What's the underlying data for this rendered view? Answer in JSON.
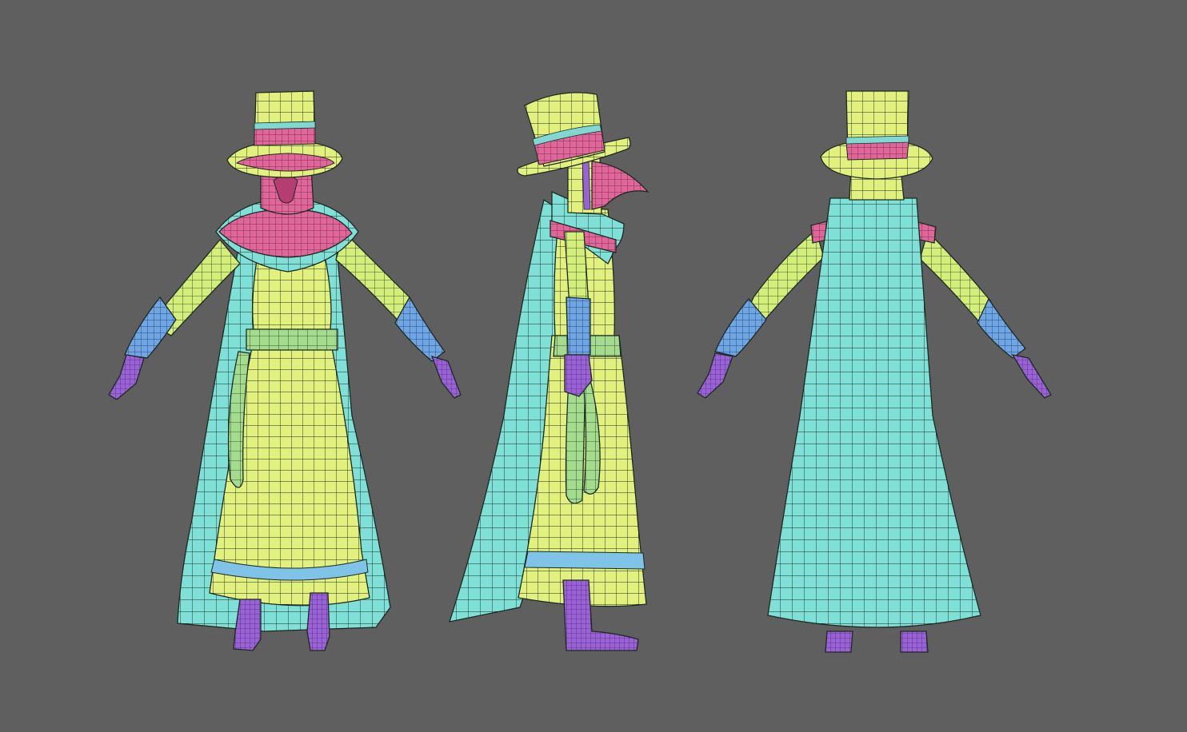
{
  "viewport": {
    "background": "#5f5f5f",
    "views": [
      "front-view",
      "side-view",
      "back-view"
    ]
  },
  "palette": {
    "hat": "#dff07a",
    "hat_band": "#d9587e",
    "hat_band_stripe": "#7fd9d2",
    "mask": "#e0669a",
    "mask_dark": "#b63d72",
    "collar_pink": "#e77aa2",
    "cape": "#7fe0d8",
    "robe": "#e2f07e",
    "robe_shadow": "#c8da60",
    "sash": "#a4dc8e",
    "robe_hem_band": "#7fc3e8",
    "arm": "#d4ee7a",
    "glove": "#6fa6e6",
    "hand": "#9a62d6",
    "boot": "#8a58c8",
    "wire": "#1d2a22"
  },
  "icons": [
    "wireframe-grid-icon"
  ]
}
